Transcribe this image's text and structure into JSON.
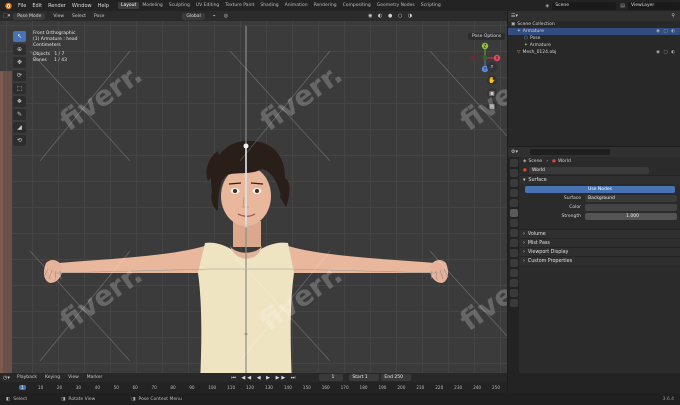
{
  "menus": [
    "File",
    "Edit",
    "Render",
    "Window",
    "Help"
  ],
  "workspaces": [
    "Layout",
    "Modeling",
    "Sculpting",
    "UV Editing",
    "Texture Paint",
    "Shading",
    "Animation",
    "Rendering",
    "Compositing",
    "Geometry Nodes",
    "Scripting"
  ],
  "active_workspace": "Layout",
  "scene_name": "Scene",
  "view_layer": "ViewLayer",
  "viewport": {
    "mode": "Pose Mode",
    "header_menus": [
      "View",
      "Select",
      "Pose"
    ],
    "orientation": "Global",
    "pose_options": "Pose Options",
    "info": {
      "view": "Front Orthographic",
      "active": "(1) Armature : head",
      "unit": "Centimeters",
      "objects_label": "Objects",
      "objects_value": "1 / 7",
      "bones_label": "Bones",
      "bones_value": "1 / 43"
    },
    "gizmo": {
      "x": "X",
      "y": "Y",
      "z": "Z"
    }
  },
  "watermark": "fiverr.",
  "outliner": {
    "title": "Scene Collection",
    "items": [
      {
        "label": "Armature",
        "selected": true,
        "indent": 1
      },
      {
        "label": "Pose",
        "selected": false,
        "indent": 2
      },
      {
        "label": "Armature",
        "selected": false,
        "indent": 2
      },
      {
        "label": "Mesh_0124.obj",
        "selected": false,
        "indent": 1
      }
    ]
  },
  "properties": {
    "breadcrumb_scene": "Scene",
    "breadcrumb_world": "World",
    "world_name": "World",
    "surface_panel": "Surface",
    "use_nodes": "Use Nodes",
    "surface_label": "Surface",
    "surface_value": "Background",
    "color_label": "Color",
    "strength_label": "Strength",
    "strength_value": "1.000",
    "panels": [
      "Volume",
      "Mist Pass",
      "Viewport Display",
      "Custom Properties"
    ]
  },
  "timeline": {
    "menus": [
      "Playback",
      "Keying",
      "View",
      "Marker"
    ],
    "current_frame": "1",
    "start_label": "Start",
    "start_value": "1",
    "end_label": "End",
    "end_value": "250",
    "frame_ticks": [
      "1",
      "10",
      "20",
      "30",
      "40",
      "50",
      "60",
      "70",
      "80",
      "90",
      "100",
      "110",
      "120",
      "130",
      "140",
      "150",
      "160",
      "170",
      "180",
      "190",
      "200",
      "210",
      "220",
      "230",
      "240",
      "250"
    ]
  },
  "status": {
    "select": "Select",
    "rotate": "Rotate View",
    "context": "Pose Context Menu",
    "version": "3.6.4"
  },
  "colors": {
    "accent": "#4772b3",
    "skin": "#e8b79c",
    "shirt": "#efe4c2",
    "hair": "#2a1e19"
  }
}
